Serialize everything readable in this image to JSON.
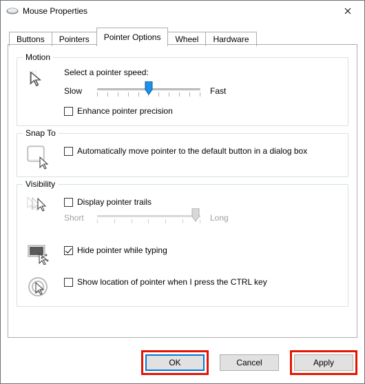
{
  "window": {
    "title": "Mouse Properties"
  },
  "tabs": {
    "items": [
      "Buttons",
      "Pointers",
      "Pointer Options",
      "Wheel",
      "Hardware"
    ],
    "active_index": 2
  },
  "motion": {
    "title": "Motion",
    "speed_label": "Select a pointer speed:",
    "slow": "Slow",
    "fast": "Fast",
    "enhance_label": "Enhance pointer precision",
    "enhance_checked": false,
    "slider_value": 5,
    "slider_max": 10
  },
  "snapto": {
    "title": "Snap To",
    "auto_label": "Automatically move pointer to the default button in a dialog box",
    "auto_checked": false
  },
  "visibility": {
    "title": "Visibility",
    "trails_label": "Display pointer trails",
    "trails_checked": false,
    "trail_short": "Short",
    "trail_long": "Long",
    "hide_label": "Hide pointer while typing",
    "hide_checked": true,
    "ctrl_label": "Show location of pointer when I press the CTRL key",
    "ctrl_checked": false
  },
  "buttons": {
    "ok": "OK",
    "cancel": "Cancel",
    "apply": "Apply"
  }
}
